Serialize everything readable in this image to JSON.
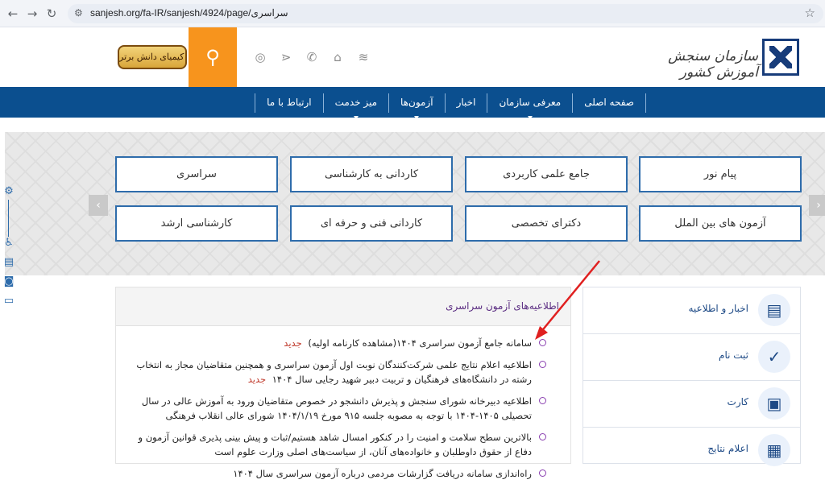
{
  "browser": {
    "url": "sanjesh.org/fa-IR/sanjesh/4924/page/سراسری",
    "back_icon": "back-arrow-icon",
    "forward_icon": "forward-arrow-icon",
    "reload_icon": "reload-icon",
    "site_info_icon": "site-settings-icon",
    "bookmark_icon": "star-icon"
  },
  "header": {
    "logo_text": "سازمان سنجش آموزش کشور",
    "seal_text": "سپیدار کیمیای دانش برتر",
    "icons": [
      "rss-icon",
      "home-icon",
      "phone-icon",
      "share-icon",
      "globe-icon"
    ]
  },
  "nav": {
    "items": [
      {
        "label": "صفحه اصلی",
        "dropdown": false
      },
      {
        "label": "معرفی سازمان",
        "dropdown": true
      },
      {
        "label": "اخبار",
        "dropdown": false
      },
      {
        "label": "آزمون‌ها",
        "dropdown": true
      },
      {
        "label": "میز خدمت",
        "dropdown": true
      },
      {
        "label": "ارتباط با ما",
        "dropdown": false
      }
    ]
  },
  "exams": {
    "row1": [
      "پیام نور",
      "جامع علمی کاربردی",
      "کاردانی به کارشناسی",
      "سراسری"
    ],
    "row2": [
      "آزمون های بین الملل",
      "دکترای تخصصی",
      "کاردانی فنی و حرفه ای",
      "کارشناسی ارشد"
    ]
  },
  "news": {
    "title": "اطلاعیه‌های آزمون سراسری",
    "new_label": "جدید",
    "items": [
      {
        "text": "سامانه جامع آزمون سراسری ۱۴۰۴(مشاهده کارنامه اولیه)",
        "is_new": true
      },
      {
        "text": "اطلاعیه اعلام نتایج علمی شرکت‌کنندگان نوبت اول آزمون سراسری و همچنین متقاضیان مجاز به انتخاب رشته در دانشگاه‌های فرهنگیان و تربیت دبیر شهید رجایی سال ۱۴۰۴",
        "is_new": true
      },
      {
        "text": "اطلاعیه دبیرخانه شورای سنجش و پذیرش دانشجو در خصوص متقاضیان ورود به آموزش عالی در سال تحصیلی ۱۴۰۵-۱۴۰۴ با توجه به مصوبه جلسه ۹۱۵ مورخ ۱۴۰۴/۱/۱۹ شورای عالی انقلاب فرهنگی",
        "is_new": false
      },
      {
        "text": "بالاترین سطح سلامت و امنیت را در کنکور امسال شاهد هستیم/ثبات و پیش بینی پذیری قوانین آزمون و دفاع از حقوق داوطلبان و خانواده‌های آنان، از سیاست‌های اصلی وزارت علوم است",
        "is_new": false
      },
      {
        "text": "راه‌اندازی سامانه دریافت گزارشات مردمی درباره آزمون سراسری سال ۱۴۰۴",
        "is_new": false
      }
    ]
  },
  "sidebar": {
    "items": [
      {
        "label": "اخبار و اطلاعیه",
        "icon": "newspaper-icon"
      },
      {
        "label": "ثبت نام",
        "icon": "clipboard-check-icon"
      },
      {
        "label": "کارت",
        "icon": "id-card-icon"
      },
      {
        "label": "اعلام نتایج",
        "icon": "results-screen-icon"
      }
    ]
  },
  "colors": {
    "nav_bg": "#0b4f8f",
    "search_orange": "#f7941d",
    "exam_border": "#2e6cab",
    "news_title": "#5b2d82",
    "new_badge": "#c0392b",
    "annotation_arrow": "#e02020"
  }
}
